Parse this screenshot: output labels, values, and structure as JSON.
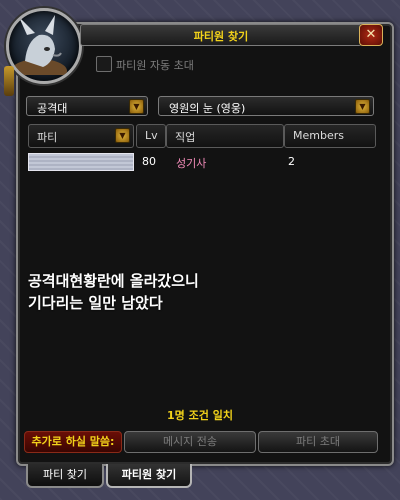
{
  "window": {
    "title": "파티원 찾기",
    "close_symbol": "✕"
  },
  "auto_invite": {
    "label": "파티원 자동 초대",
    "checked": false
  },
  "filters": {
    "category": "공격대",
    "dungeon": "영원의 눈 (영웅)"
  },
  "table": {
    "headers": {
      "party": "파티",
      "lv": "Lv",
      "class": "직업",
      "members": "Members"
    },
    "rows": [
      {
        "name": "",
        "lv": "80",
        "class": "성기사",
        "members": "2",
        "class_color": "#f48cba"
      }
    ]
  },
  "chat_overlay": {
    "line1": "공격대현황란에 올라갔으니",
    "line2": "기다리는 일만 남았다"
  },
  "match_status": "1명 조건 일치",
  "buttons": {
    "add_comment": "추가로 하실 말씀:",
    "send_message": "메시지 전송",
    "party_invite": "파티 초대"
  },
  "tabs": {
    "find_party": "파티 찾기",
    "find_members": "파티원 찾기"
  },
  "colors": {
    "accent_gold": "#f2d21a",
    "frame_border": "#8a8a8a"
  }
}
